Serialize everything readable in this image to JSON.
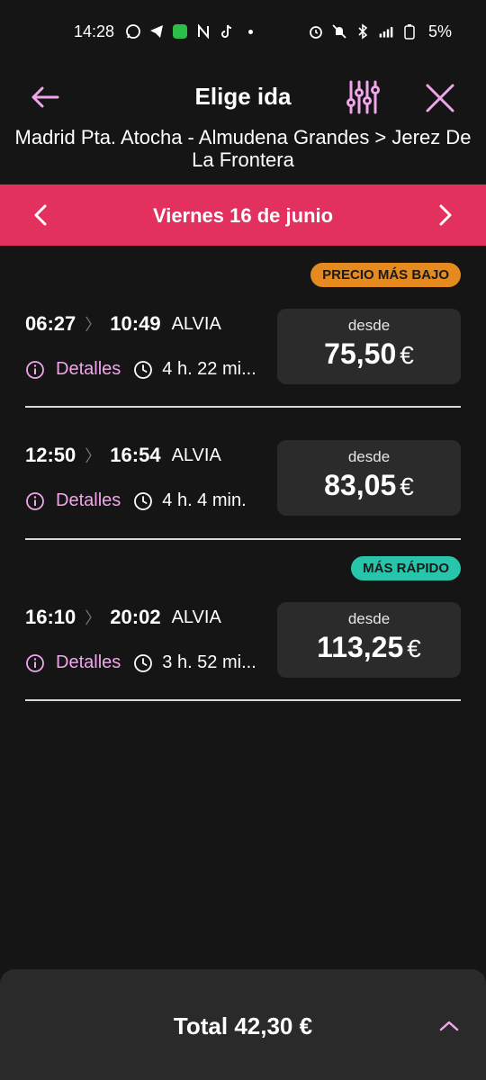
{
  "status_bar": {
    "time": "14:28",
    "battery": "5%",
    "icons": [
      "whatsapp-icon",
      "telegram-icon",
      "messages-icon",
      "n-app-icon",
      "tiktok-icon",
      "dot-icon",
      "alarm-icon",
      "mute-icon",
      "bluetooth-icon",
      "signal-5g-icon",
      "battery-icon"
    ]
  },
  "header": {
    "title": "Elige ida",
    "route": "Madrid Pta. Atocha - Almudena Grandes > Jerez De La Frontera"
  },
  "date_bar": {
    "date": "Viernes 16 de junio",
    "color": "#e2305f"
  },
  "trips": [
    {
      "badge": "PRECIO MÁS BAJO",
      "badge_color": "#e58a1f",
      "departure": "06:27",
      "arrival": "10:49",
      "train": "ALVIA",
      "details": "Detalles",
      "duration": "4 h. 22 mi...",
      "from_label": "desde",
      "price": "75,50",
      "currency": "€"
    },
    {
      "badge": "",
      "departure": "12:50",
      "arrival": "16:54",
      "train": "ALVIA",
      "details": "Detalles",
      "duration": "4 h. 4 min.",
      "from_label": "desde",
      "price": "83,05",
      "currency": "€"
    },
    {
      "badge": "MÁS RÁPIDO",
      "badge_color": "#27c5a9",
      "departure": "16:10",
      "arrival": "20:02",
      "train": "ALVIA",
      "details": "Detalles",
      "duration": "3 h. 52 mi...",
      "from_label": "desde",
      "price": "113,25",
      "currency": "€"
    }
  ],
  "footer": {
    "total": "Total 42,30 €"
  },
  "colors": {
    "accent": "#f0a6ea",
    "background": "#151515",
    "card": "#2b2b2b"
  }
}
